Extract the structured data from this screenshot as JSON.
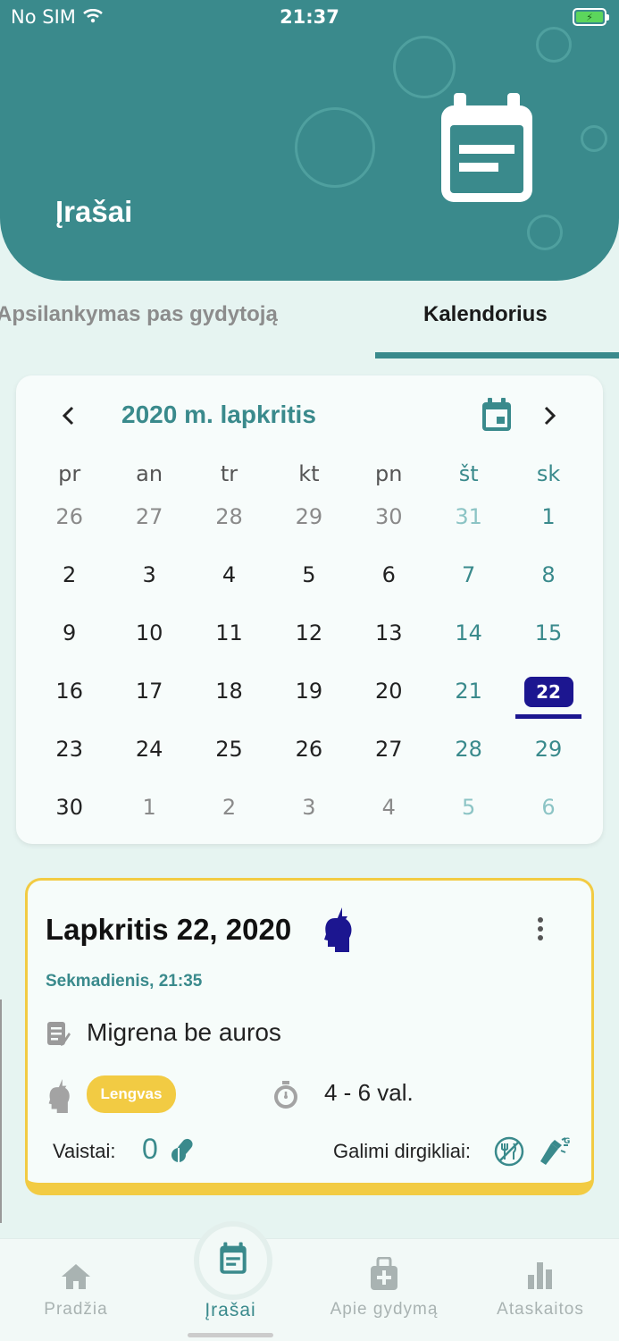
{
  "status_bar": {
    "carrier": "No SIM",
    "time": "21:37"
  },
  "header": {
    "title": "Įrašai"
  },
  "tabs": [
    {
      "label": "Apsilankymas pas gydytoją",
      "active": false
    },
    {
      "label": "Kalendorius",
      "active": true
    }
  ],
  "calendar": {
    "title": "2020 m. lapkritis",
    "weekdays": [
      "pr",
      "an",
      "tr",
      "kt",
      "pn",
      "št",
      "sk"
    ],
    "weeks": [
      [
        "26",
        "27",
        "28",
        "29",
        "30",
        "31",
        "1"
      ],
      [
        "2",
        "3",
        "4",
        "5",
        "6",
        "7",
        "8"
      ],
      [
        "9",
        "10",
        "11",
        "12",
        "13",
        "14",
        "15"
      ],
      [
        "16",
        "17",
        "18",
        "19",
        "20",
        "21",
        "22"
      ],
      [
        "23",
        "24",
        "25",
        "26",
        "27",
        "28",
        "29"
      ],
      [
        "30",
        "1",
        "2",
        "3",
        "4",
        "5",
        "6"
      ]
    ],
    "selected_day": "22"
  },
  "entry": {
    "date": "Lapkritis 22, 2020",
    "subtitle": "Sekmadienis, 21:35",
    "diagnosis": "Migrena be auros",
    "severity": "Lengvas",
    "duration": "4 - 6 val.",
    "medications_label": "Vaistai:",
    "medications_count": "0",
    "triggers_label": "Galimi dirgikliai:"
  },
  "bottom_nav": {
    "home": "Pradžia",
    "entries": "Įrašai",
    "treatment": "Apie gydymą",
    "reports": "Ataskaitos"
  },
  "colors": {
    "primary": "#3a8a8c",
    "selected": "#1c1690",
    "accent": "#f2cb43"
  }
}
